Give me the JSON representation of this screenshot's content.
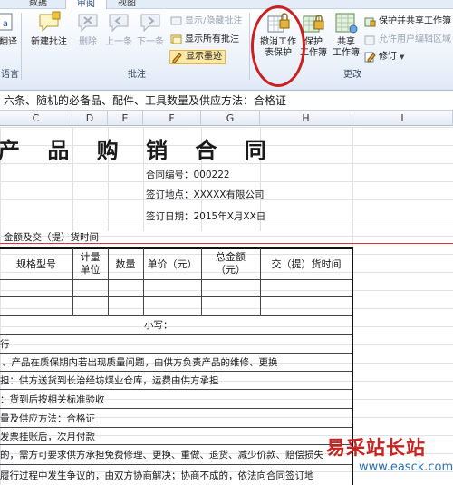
{
  "tabs": [
    "数据",
    "审阅",
    "视图"
  ],
  "ribbon": {
    "left_partial_btn": "a",
    "left_partial_label": "翻译",
    "left_group_label": "语言",
    "comment_group": {
      "label": "批注",
      "new_comment": "新建批注",
      "delete": "删除",
      "prev": "上一条",
      "next": "下一条",
      "show_hide_comment": "显示/隐藏批注",
      "show_all_comments": "显示所有批注",
      "show_ink": "显示墨迹"
    },
    "changes_group": {
      "label": "更改",
      "unprotect_sheet": "撤消工作\n表保护",
      "protect_workbook": "保护\n工作簿",
      "share_workbook": "共享\n工作簿",
      "protect_share": "保护并共享工作簿",
      "allow_edit_ranges": "允许用户编辑区域",
      "track_changes": "修订"
    }
  },
  "formula_bar": {
    "text": "六条、随机的必备品、配件、工具数量及供应方法：合格证"
  },
  "columns": [
    "C",
    "D",
    "E",
    "F",
    "G",
    "H",
    "I"
  ],
  "sheet": {
    "title": "产 品 购 销 合 同",
    "title_visible": "产 品 购 销 合 同",
    "contract_no": "合同编号：000222",
    "sign_place": "签订地点：XXXXX有限公司",
    "sign_date": "签订日期：2015年X月XX日",
    "section1": "金额及交（提）货时间",
    "table_headers": [
      "规格型号",
      "计量\n单位",
      "数量",
      "单价（元）",
      "总金额\n（元）",
      "交（提）货时间"
    ],
    "small_caps": "小写：",
    "row_a": "行",
    "row_b": "、产品在质保期内若出现质量问题，由供方负责产品的维修、更换",
    "row_c": "担：供方送货到长治经坊煤业仓库，运费由供方承担",
    "row_d": "：货到后按相关标准验收",
    "row_e": "量及供应方法：合格证",
    "row_f": "发票挂账后，次月付款",
    "row_g": "的，需方可要求供方承担免费修理、更换、重做、退货、减少价款、赔偿损失",
    "row_h": "履行过程中发生争议的，由双方协商解决；协商不成的，依法向合同签订地"
  },
  "watermark": {
    "text": "易采站长站",
    "url": "www.easck.com"
  }
}
